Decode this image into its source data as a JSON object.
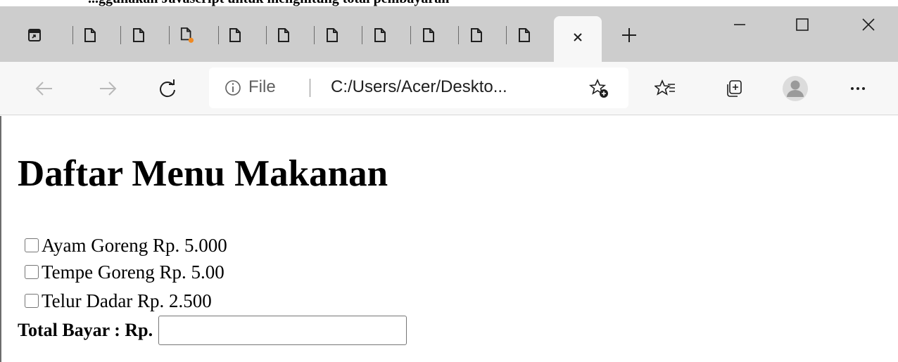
{
  "top_strip": {
    "text": "...ggunakan Javascript untuk menghitung total pembayaran"
  },
  "tabs": [
    {
      "icon": "edge-page-icon"
    },
    {
      "icon": "page-icon"
    },
    {
      "icon": "page-icon"
    },
    {
      "icon": "page-icon-with-update-dot"
    },
    {
      "icon": "page-icon"
    },
    {
      "icon": "page-icon"
    },
    {
      "icon": "page-icon"
    },
    {
      "icon": "page-icon"
    },
    {
      "icon": "page-icon"
    },
    {
      "icon": "page-icon"
    },
    {
      "icon": "page-icon"
    },
    {
      "icon": "close-icon",
      "active": true
    }
  ],
  "window_controls": [
    "minimize",
    "maximize",
    "close"
  ],
  "address_bar": {
    "info_label": "File",
    "url": "C:/Users/Acer/Deskto..."
  },
  "page": {
    "heading": "Daftar Menu Makanan",
    "items": [
      {
        "label": "Ayam Goreng Rp. 5.000",
        "checked": false
      },
      {
        "label": "Tempe Goreng Rp. 5.00",
        "checked": false
      },
      {
        "label": "Telur Dadar Rp. 2.500",
        "checked": false
      }
    ],
    "total_label": "Total Bayar : Rp.",
    "total_value": ""
  },
  "colors": {
    "tabstrip": "#cdcdcd",
    "toolbar": "#f7f7f7",
    "update_dot": "#f08a24"
  }
}
